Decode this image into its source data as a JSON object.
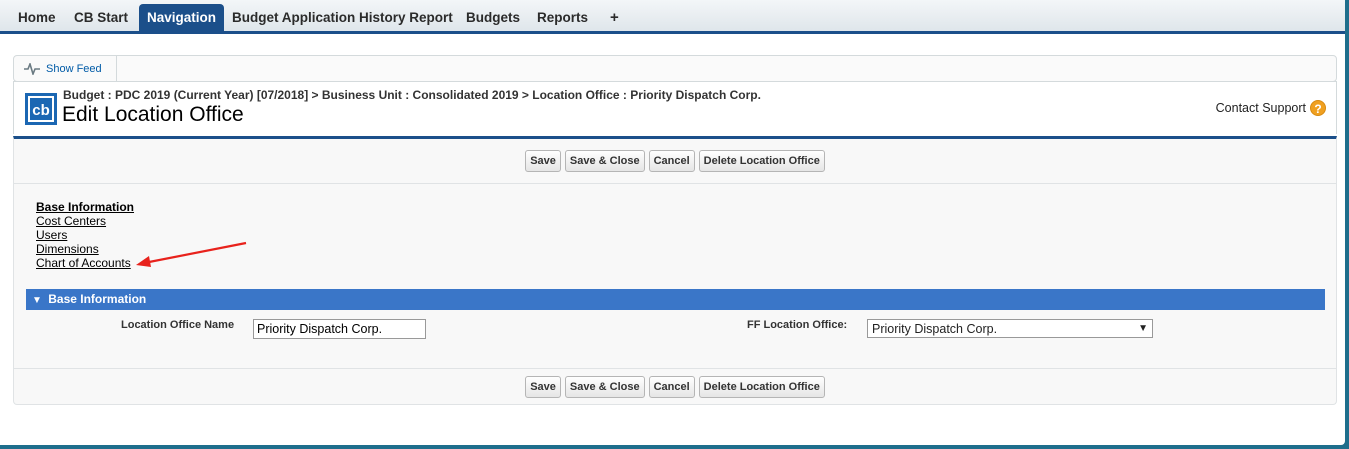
{
  "tabs": [
    {
      "label": "Home"
    },
    {
      "label": "CB Start"
    },
    {
      "label": "Navigation"
    },
    {
      "label": "Budget Application History Report"
    },
    {
      "label": "Budgets"
    },
    {
      "label": "Reports"
    },
    {
      "label": "+"
    }
  ],
  "feed": {
    "label": "Show Feed"
  },
  "header": {
    "logo_text": "cb",
    "breadcrumb": "Budget : PDC 2019 (Current Year) [07/2018] > Business Unit : Consolidated 2019 > Location Office : Priority Dispatch Corp.",
    "title": "Edit Location Office",
    "support": "Contact Support",
    "help_glyph": "?"
  },
  "buttons": {
    "save": "Save",
    "save_close": "Save & Close",
    "cancel": "Cancel",
    "delete": "Delete Location Office"
  },
  "nav_links": [
    {
      "label": "Base Information"
    },
    {
      "label": "Cost Centers"
    },
    {
      "label": "Users"
    },
    {
      "label": "Dimensions"
    },
    {
      "label": "Chart of Accounts"
    }
  ],
  "section": {
    "title": "Base Information",
    "toggle": "▼"
  },
  "form": {
    "name_label": "Location Office Name",
    "name_value": "Priority Dispatch Corp.",
    "ff_label": "FF Location Office:",
    "ff_value": "Priority Dispatch Corp.",
    "ff_caret": "▼"
  },
  "colors": {
    "accent": "#1b4f8a",
    "section": "#3a76c8",
    "annotation_arrow": "#e8221c"
  }
}
